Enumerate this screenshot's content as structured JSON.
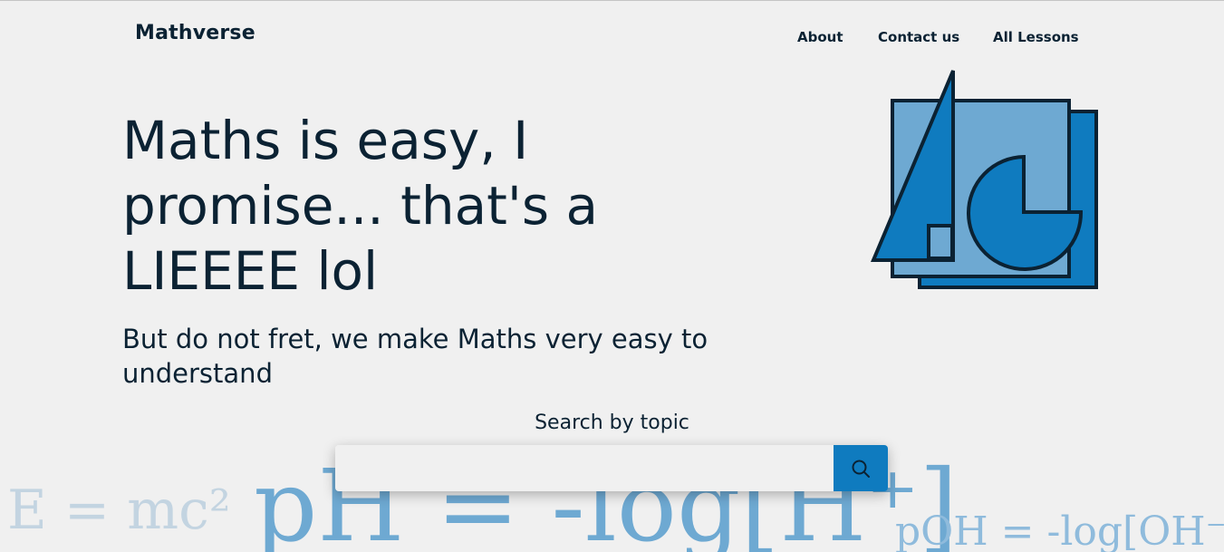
{
  "brand": {
    "name": "Mathverse"
  },
  "nav": {
    "items": [
      {
        "label": "About"
      },
      {
        "label": "Contact us"
      },
      {
        "label": "All Lessons"
      }
    ]
  },
  "hero": {
    "title": "Maths is easy, I promise... that's a LIEEEE lol",
    "subtitle": "But do not fret, we make Maths very easy to understand"
  },
  "search": {
    "label": "Search by topic",
    "value": "",
    "placeholder": "",
    "button_icon": "search-icon"
  },
  "background_formulas": [
    {
      "text": "E = mc²"
    },
    {
      "text": "pH = -log[H⁺]"
    },
    {
      "text": "pOH = -log[OH⁻]"
    }
  ],
  "illustration": {
    "icon": "geometry-shapes-icon"
  },
  "colors": {
    "background": "#f0f0f0",
    "text": "#0b2233",
    "accent": "#0f7bbf",
    "accent_light": "#6ea9d2",
    "outline": "#0b2233"
  }
}
